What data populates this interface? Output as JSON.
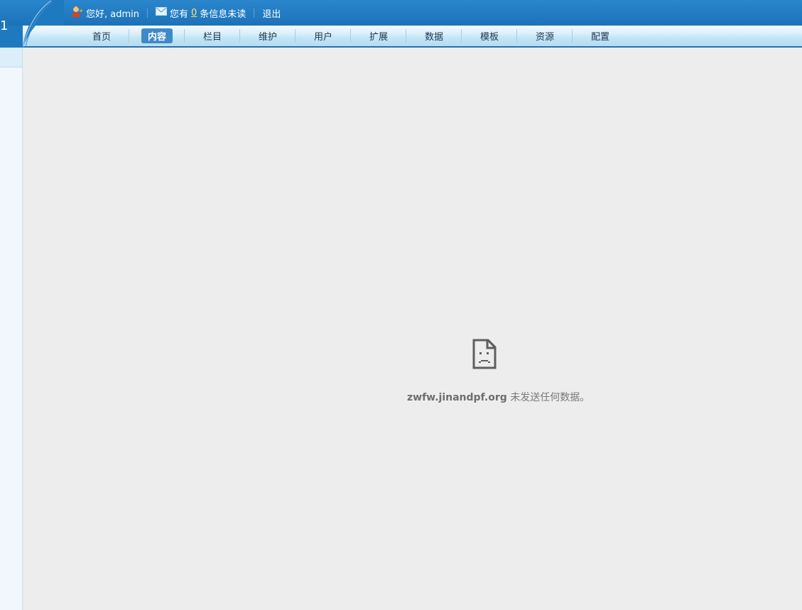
{
  "header": {
    "logo_fragment": "1",
    "greeting": "您好, admin",
    "messages_prefix": "您有",
    "messages_count": "0",
    "messages_suffix": "条信息未读",
    "logout": "退出",
    "icons": {
      "user": "user-icon",
      "mail": "mail-icon"
    }
  },
  "nav": {
    "tabs": [
      {
        "label": "首页"
      },
      {
        "label": "内容"
      },
      {
        "label": "栏目"
      },
      {
        "label": "维护"
      },
      {
        "label": "用户"
      },
      {
        "label": "扩展"
      },
      {
        "label": "数据"
      },
      {
        "label": "模板"
      },
      {
        "label": "资源"
      },
      {
        "label": "配置"
      }
    ],
    "active_label": "内容"
  },
  "main": {
    "error_host": "zwfw.jinandpf.org",
    "error_message": " 未发送任何数据。",
    "error_icon": "sad-page-icon"
  },
  "colors": {
    "header_blue": "#1f79bf",
    "active_tab": "#3d8ac9",
    "unread_count": "#ffe66b",
    "content_bg": "#ededed"
  }
}
